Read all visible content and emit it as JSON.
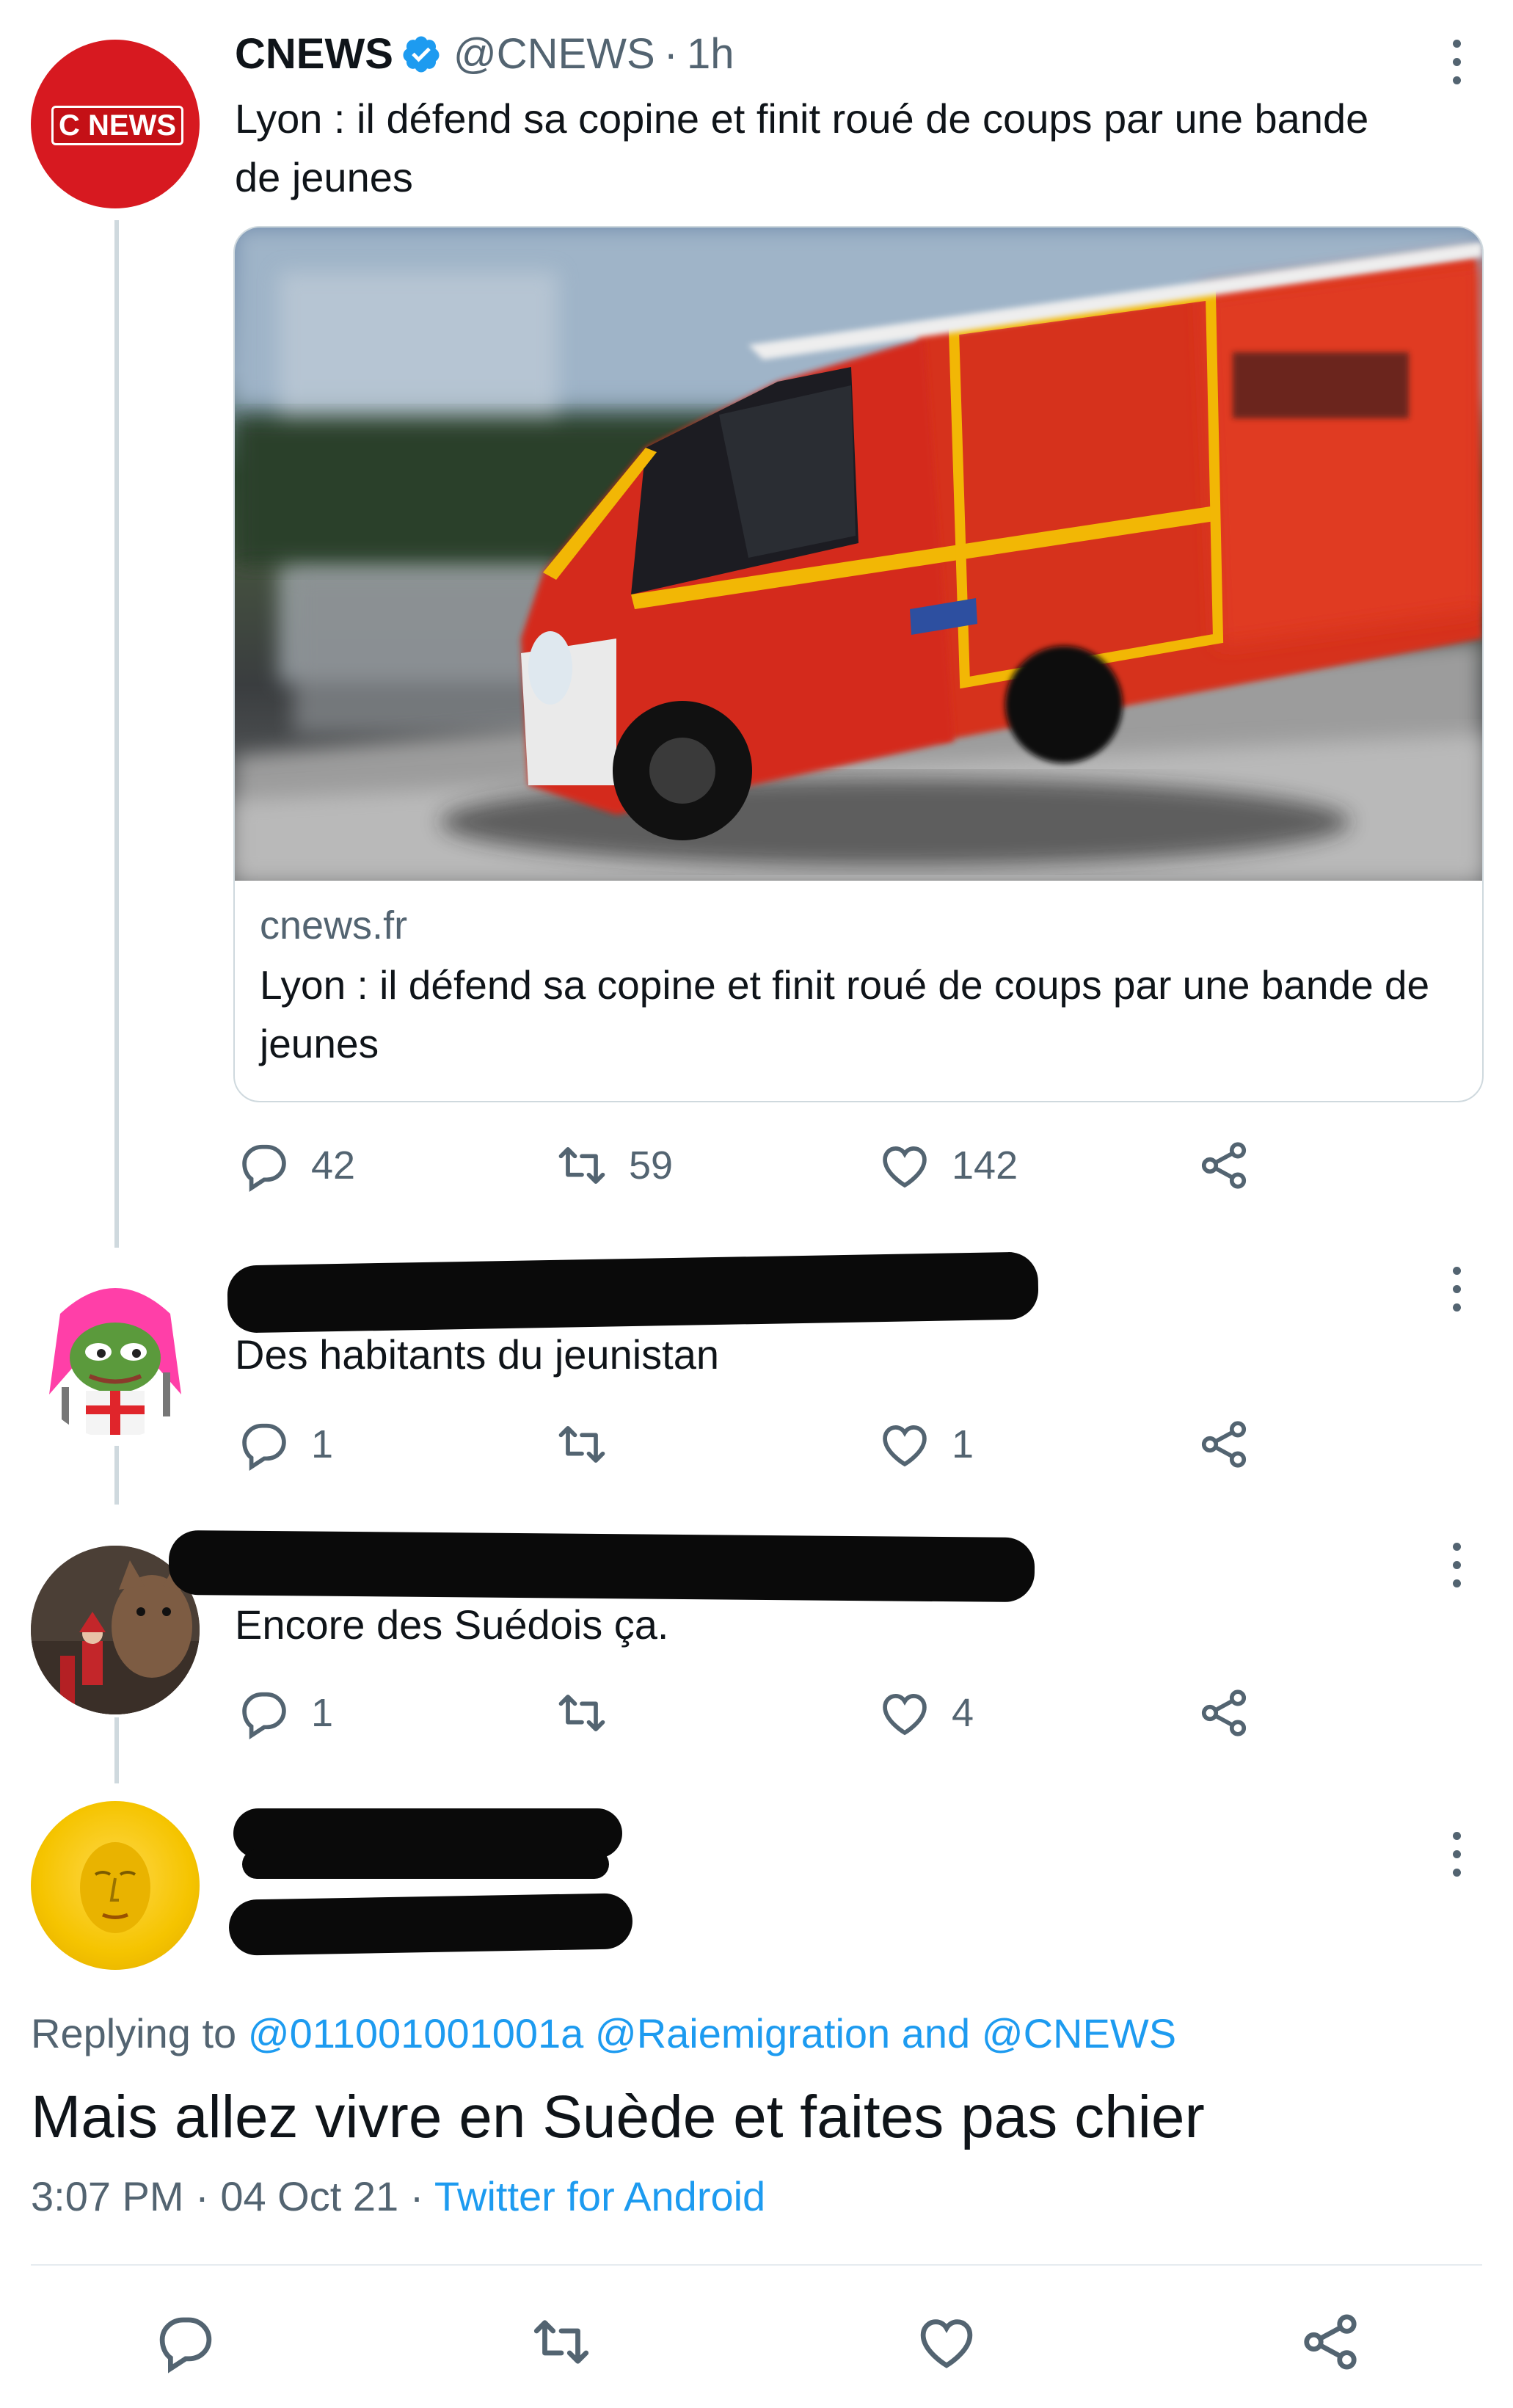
{
  "tweet": {
    "name": "CNEWS",
    "handle": "@CNEWS",
    "sep": "·",
    "time": "1h",
    "text": "Lyon : il défend sa copine et finit roué de coups par une bande de jeunes",
    "avatar_text": "C NEWS",
    "card": {
      "domain": "cnews.fr",
      "title": "Lyon : il défend sa copine et finit roué de coups par une bande de jeunes",
      "image_alt": "Fire department ambulance in motion"
    },
    "counts": {
      "replies": "42",
      "retweets": "59",
      "likes": "142"
    }
  },
  "replies": [
    {
      "text": "Des habitants du jeunistan",
      "replies": "1",
      "retweets": "",
      "likes": "1"
    },
    {
      "text": "Encore des Suédois ça.",
      "replies": "1",
      "retweets": "",
      "likes": "4"
    }
  ],
  "focused": {
    "replying_prefix": "Replying to",
    "replying_users": "@011001001001a @Raiemigration and @CNEWS",
    "text": "Mais allez vivre en Suède et faites pas chier",
    "timestamp": "3:07 PM · 04 Oct 21 ·",
    "client": "Twitter for Android"
  },
  "colors": {
    "accent": "#1d9bf0",
    "muted": "#536471",
    "brand_red": "#d71920"
  },
  "icons": [
    "reply-icon",
    "retweet-icon",
    "like-icon",
    "share-icon",
    "more-icon",
    "verified-icon"
  ]
}
